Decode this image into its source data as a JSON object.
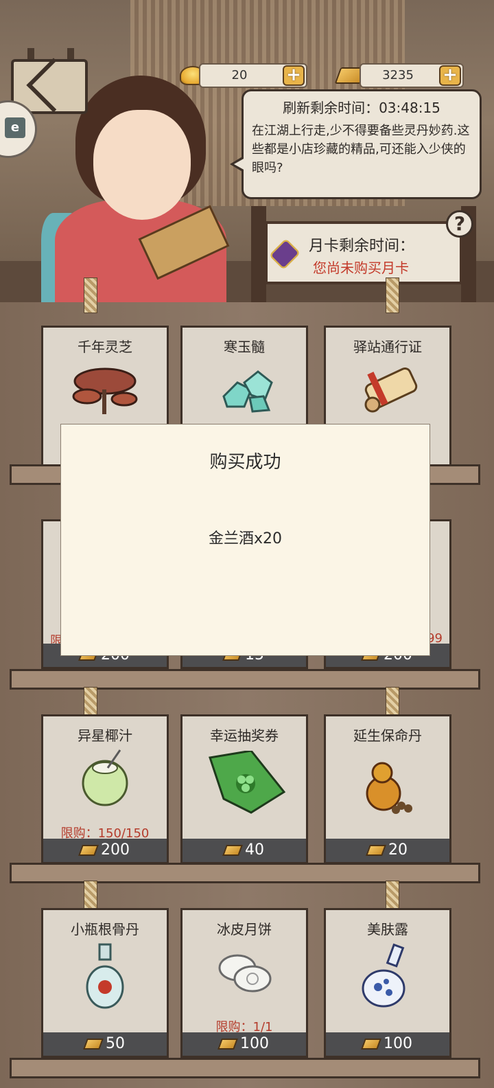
{
  "header": {
    "currency_ingot": "20",
    "currency_gold": "3235",
    "refresh_timer": "刷新剩余时间：03:48:15",
    "shopkeeper_text": "在江湖上行走,少不得要备些灵丹妙药.这些都是小店珍藏的精品,可还能入少侠的眼吗?",
    "monthly_card_title": "月卡剩余时间：",
    "monthly_card_status": "您尚未购买月卡",
    "help_label": "?"
  },
  "shop": {
    "row1": [
      {
        "name": "千年灵芝",
        "icon": "lingzhi-mushroom-icon"
      },
      {
        "name": "寒玉髓",
        "icon": "jade-crystal-icon"
      },
      {
        "name": "驿站通行证",
        "icon": "scroll-pass-icon"
      }
    ],
    "row2": [
      {
        "limit_partial": "限",
        "price": "200"
      },
      {
        "price": "15"
      },
      {
        "limit_partial": "99",
        "price": "200"
      }
    ],
    "row3": [
      {
        "name": "异星椰汁",
        "icon": "coconut-icon",
        "limit": "限购：150/150",
        "price": "200"
      },
      {
        "name": "幸运抽奖券",
        "icon": "lottery-ticket-icon",
        "price": "40"
      },
      {
        "name": "延生保命丹",
        "icon": "gourd-pills-icon",
        "price": "20"
      }
    ],
    "row4": [
      {
        "name": "小瓶根骨丹",
        "icon": "medicine-bottle-icon",
        "price": "50"
      },
      {
        "name": "冰皮月饼",
        "icon": "mooncake-icon",
        "limit": "限购：1/1",
        "price": "100"
      },
      {
        "name": "美肤露",
        "icon": "porcelain-vase-icon",
        "price": "100"
      }
    ]
  },
  "modal": {
    "title": "购买成功",
    "message": "金兰酒x20"
  },
  "colors": {
    "limit_red": "#b43c2c",
    "price_bar": "#4d4d4f",
    "modal_bg": "#fbf5e6"
  }
}
